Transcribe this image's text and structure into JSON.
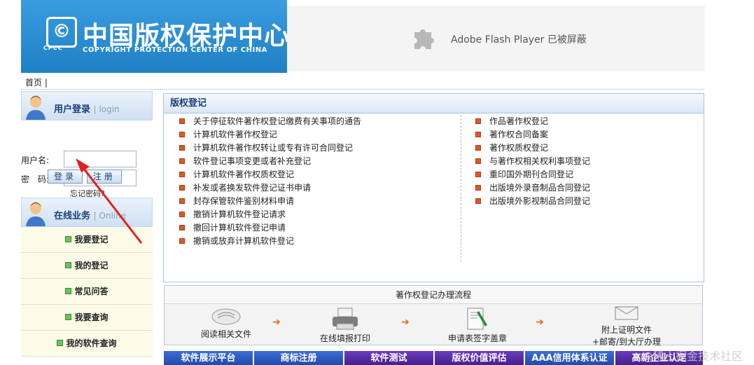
{
  "header": {
    "logo_mark": "©",
    "logo_mark_sub": "CPCC",
    "logo_cn": "中国版权保护中心",
    "logo_en": "COPYRIGHT PROTECTION CENTER OF CHINA",
    "flash_text": "Adobe Flash Player 已被屏蔽"
  },
  "breadcrumb": {
    "home": "首页",
    "sep": "|"
  },
  "login": {
    "title": "用户登录",
    "sub": "| login",
    "username_label": "用户名:",
    "password_label": "密　码:",
    "username_value": "",
    "password_value": "",
    "forgot": "忘记密码?",
    "login_button": "登录",
    "register_button": "注册"
  },
  "online": {
    "title": "在线业务",
    "sub": "| Online",
    "items": [
      "我要登记",
      "我的登记",
      "常见问答",
      "我要查询",
      "我的软件查询"
    ]
  },
  "registration": {
    "title": "版权登记",
    "left_links": [
      "关于停征软件著作权登记缴费有关事项的通告",
      "计算机软件著作权登记",
      "计算机软件著作权转让或专有许可合同登记",
      "软件登记事项变更或者补充登记",
      "计算机软件著作权质权登记",
      "补发或者换发软件登记证书申请",
      "封存保管软件鉴别材料申请",
      "撤销计算机软件登记请求",
      "撤回计算机软件登记申请",
      "撤销或放弃计算机软件登记"
    ],
    "right_links": [
      "作品著作权登记",
      "著作权合同备案",
      "著作权质权登记",
      "与著作权相关权利事项登记",
      "重印国外期刊合同登记",
      "出版境外录音制品合同登记",
      "出版境外影视制品合同登记"
    ]
  },
  "process": {
    "title": "著作权登记办理流程",
    "steps": [
      "阅读相关文件",
      "在线填报打印",
      "申请表签字盖章",
      "附上证明文件",
      "+邮寄/到大厅办理"
    ],
    "arrow": "➔"
  },
  "banners": [
    "软件展示平台",
    "商标注册",
    "软件测试",
    "版权价值评估",
    "AAA信用体系认证",
    "高新企业认定"
  ],
  "watermark": "@稀土掘金技术社区",
  "colors": {
    "header_blue": "#2c8fd3",
    "panel_title": "#1a3f7a",
    "bullet_red": "#d95a2b",
    "bullet_green": "#6cc25c",
    "arrow_orange": "#e8651a",
    "banner_blue": "#2f5fc6",
    "banner_purple": "#5a2ea8",
    "annotation_red": "#e02020"
  }
}
